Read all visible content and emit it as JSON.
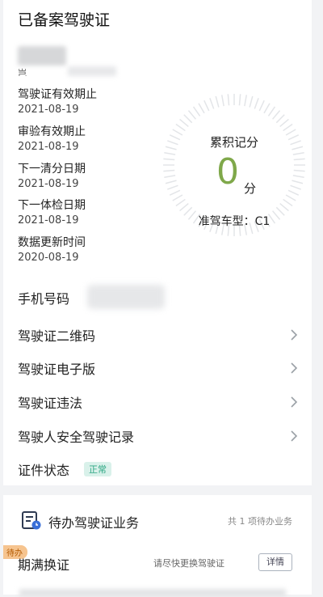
{
  "card": {
    "title": "已备案驾驶证",
    "name_stub": "岂",
    "info": [
      {
        "label": "驾驶证有效期止",
        "date": "2021-08-19"
      },
      {
        "label": "审验有效期止",
        "date": "2021-08-19"
      },
      {
        "label": "下一清分日期",
        "date": "2021-08-19"
      },
      {
        "label": "下一体检日期",
        "date": "2021-08-19"
      },
      {
        "label": "数据更新时间",
        "date": "2020-08-19"
      }
    ],
    "dial": {
      "label": "累积记分",
      "score": "0",
      "unit": "分",
      "car_type": "准驾车型：C1",
      "color": "#7fa84a"
    },
    "phone_label": "手机号码",
    "menu": [
      {
        "label": "驾驶证二维码",
        "icon": "chevron-right-icon"
      },
      {
        "label": "驾驶证电子版",
        "icon": "chevron-right-icon"
      },
      {
        "label": "驾驶证违法",
        "icon": "chevron-right-icon"
      },
      {
        "label": "驾驶人安全驾驶记录",
        "icon": "chevron-right-icon"
      }
    ],
    "status_label": "证件状态",
    "status_value": "正常",
    "status_color": "#2fa784"
  },
  "todo": {
    "icon": "document-clock-icon",
    "title": "待办驾驶证业务",
    "count_text": "共 1 项待办业务",
    "tag": "待办",
    "item_title": "期满换证",
    "item_hint": "请尽快更换驾驶证",
    "detail_label": "详情"
  }
}
